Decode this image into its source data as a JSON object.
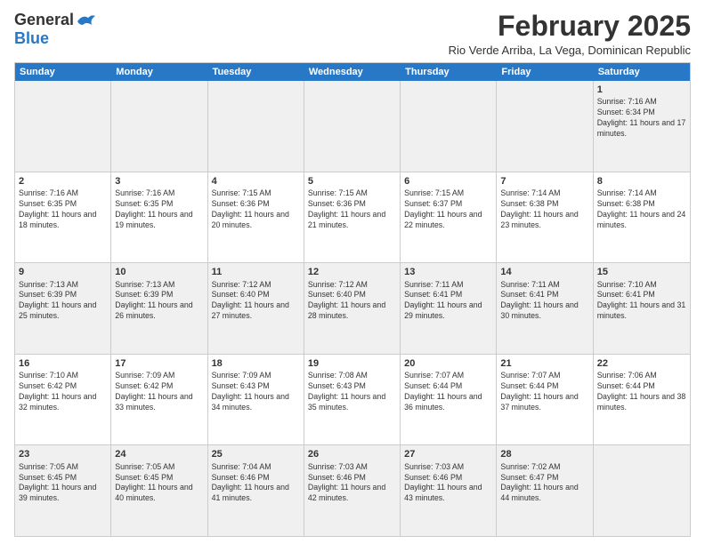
{
  "header": {
    "logo_general": "General",
    "logo_blue": "Blue",
    "month_title": "February 2025",
    "subtitle": "Rio Verde Arriba, La Vega, Dominican Republic"
  },
  "calendar": {
    "days_of_week": [
      "Sunday",
      "Monday",
      "Tuesday",
      "Wednesday",
      "Thursday",
      "Friday",
      "Saturday"
    ],
    "weeks": [
      [
        {
          "day": "",
          "empty": true
        },
        {
          "day": "",
          "empty": true
        },
        {
          "day": "",
          "empty": true
        },
        {
          "day": "",
          "empty": true
        },
        {
          "day": "",
          "empty": true
        },
        {
          "day": "",
          "empty": true
        },
        {
          "day": "1",
          "sunrise": "Sunrise: 7:16 AM",
          "sunset": "Sunset: 6:34 PM",
          "daylight": "Daylight: 11 hours and 17 minutes."
        }
      ],
      [
        {
          "day": "2",
          "sunrise": "Sunrise: 7:16 AM",
          "sunset": "Sunset: 6:35 PM",
          "daylight": "Daylight: 11 hours and 18 minutes."
        },
        {
          "day": "3",
          "sunrise": "Sunrise: 7:16 AM",
          "sunset": "Sunset: 6:35 PM",
          "daylight": "Daylight: 11 hours and 19 minutes."
        },
        {
          "day": "4",
          "sunrise": "Sunrise: 7:15 AM",
          "sunset": "Sunset: 6:36 PM",
          "daylight": "Daylight: 11 hours and 20 minutes."
        },
        {
          "day": "5",
          "sunrise": "Sunrise: 7:15 AM",
          "sunset": "Sunset: 6:36 PM",
          "daylight": "Daylight: 11 hours and 21 minutes."
        },
        {
          "day": "6",
          "sunrise": "Sunrise: 7:15 AM",
          "sunset": "Sunset: 6:37 PM",
          "daylight": "Daylight: 11 hours and 22 minutes."
        },
        {
          "day": "7",
          "sunrise": "Sunrise: 7:14 AM",
          "sunset": "Sunset: 6:38 PM",
          "daylight": "Daylight: 11 hours and 23 minutes."
        },
        {
          "day": "8",
          "sunrise": "Sunrise: 7:14 AM",
          "sunset": "Sunset: 6:38 PM",
          "daylight": "Daylight: 11 hours and 24 minutes."
        }
      ],
      [
        {
          "day": "9",
          "sunrise": "Sunrise: 7:13 AM",
          "sunset": "Sunset: 6:39 PM",
          "daylight": "Daylight: 11 hours and 25 minutes."
        },
        {
          "day": "10",
          "sunrise": "Sunrise: 7:13 AM",
          "sunset": "Sunset: 6:39 PM",
          "daylight": "Daylight: 11 hours and 26 minutes."
        },
        {
          "day": "11",
          "sunrise": "Sunrise: 7:12 AM",
          "sunset": "Sunset: 6:40 PM",
          "daylight": "Daylight: 11 hours and 27 minutes."
        },
        {
          "day": "12",
          "sunrise": "Sunrise: 7:12 AM",
          "sunset": "Sunset: 6:40 PM",
          "daylight": "Daylight: 11 hours and 28 minutes."
        },
        {
          "day": "13",
          "sunrise": "Sunrise: 7:11 AM",
          "sunset": "Sunset: 6:41 PM",
          "daylight": "Daylight: 11 hours and 29 minutes."
        },
        {
          "day": "14",
          "sunrise": "Sunrise: 7:11 AM",
          "sunset": "Sunset: 6:41 PM",
          "daylight": "Daylight: 11 hours and 30 minutes."
        },
        {
          "day": "15",
          "sunrise": "Sunrise: 7:10 AM",
          "sunset": "Sunset: 6:41 PM",
          "daylight": "Daylight: 11 hours and 31 minutes."
        }
      ],
      [
        {
          "day": "16",
          "sunrise": "Sunrise: 7:10 AM",
          "sunset": "Sunset: 6:42 PM",
          "daylight": "Daylight: 11 hours and 32 minutes."
        },
        {
          "day": "17",
          "sunrise": "Sunrise: 7:09 AM",
          "sunset": "Sunset: 6:42 PM",
          "daylight": "Daylight: 11 hours and 33 minutes."
        },
        {
          "day": "18",
          "sunrise": "Sunrise: 7:09 AM",
          "sunset": "Sunset: 6:43 PM",
          "daylight": "Daylight: 11 hours and 34 minutes."
        },
        {
          "day": "19",
          "sunrise": "Sunrise: 7:08 AM",
          "sunset": "Sunset: 6:43 PM",
          "daylight": "Daylight: 11 hours and 35 minutes."
        },
        {
          "day": "20",
          "sunrise": "Sunrise: 7:07 AM",
          "sunset": "Sunset: 6:44 PM",
          "daylight": "Daylight: 11 hours and 36 minutes."
        },
        {
          "day": "21",
          "sunrise": "Sunrise: 7:07 AM",
          "sunset": "Sunset: 6:44 PM",
          "daylight": "Daylight: 11 hours and 37 minutes."
        },
        {
          "day": "22",
          "sunrise": "Sunrise: 7:06 AM",
          "sunset": "Sunset: 6:44 PM",
          "daylight": "Daylight: 11 hours and 38 minutes."
        }
      ],
      [
        {
          "day": "23",
          "sunrise": "Sunrise: 7:05 AM",
          "sunset": "Sunset: 6:45 PM",
          "daylight": "Daylight: 11 hours and 39 minutes."
        },
        {
          "day": "24",
          "sunrise": "Sunrise: 7:05 AM",
          "sunset": "Sunset: 6:45 PM",
          "daylight": "Daylight: 11 hours and 40 minutes."
        },
        {
          "day": "25",
          "sunrise": "Sunrise: 7:04 AM",
          "sunset": "Sunset: 6:46 PM",
          "daylight": "Daylight: 11 hours and 41 minutes."
        },
        {
          "day": "26",
          "sunrise": "Sunrise: 7:03 AM",
          "sunset": "Sunset: 6:46 PM",
          "daylight": "Daylight: 11 hours and 42 minutes."
        },
        {
          "day": "27",
          "sunrise": "Sunrise: 7:03 AM",
          "sunset": "Sunset: 6:46 PM",
          "daylight": "Daylight: 11 hours and 43 minutes."
        },
        {
          "day": "28",
          "sunrise": "Sunrise: 7:02 AM",
          "sunset": "Sunset: 6:47 PM",
          "daylight": "Daylight: 11 hours and 44 minutes."
        },
        {
          "day": "",
          "empty": true
        }
      ]
    ]
  }
}
